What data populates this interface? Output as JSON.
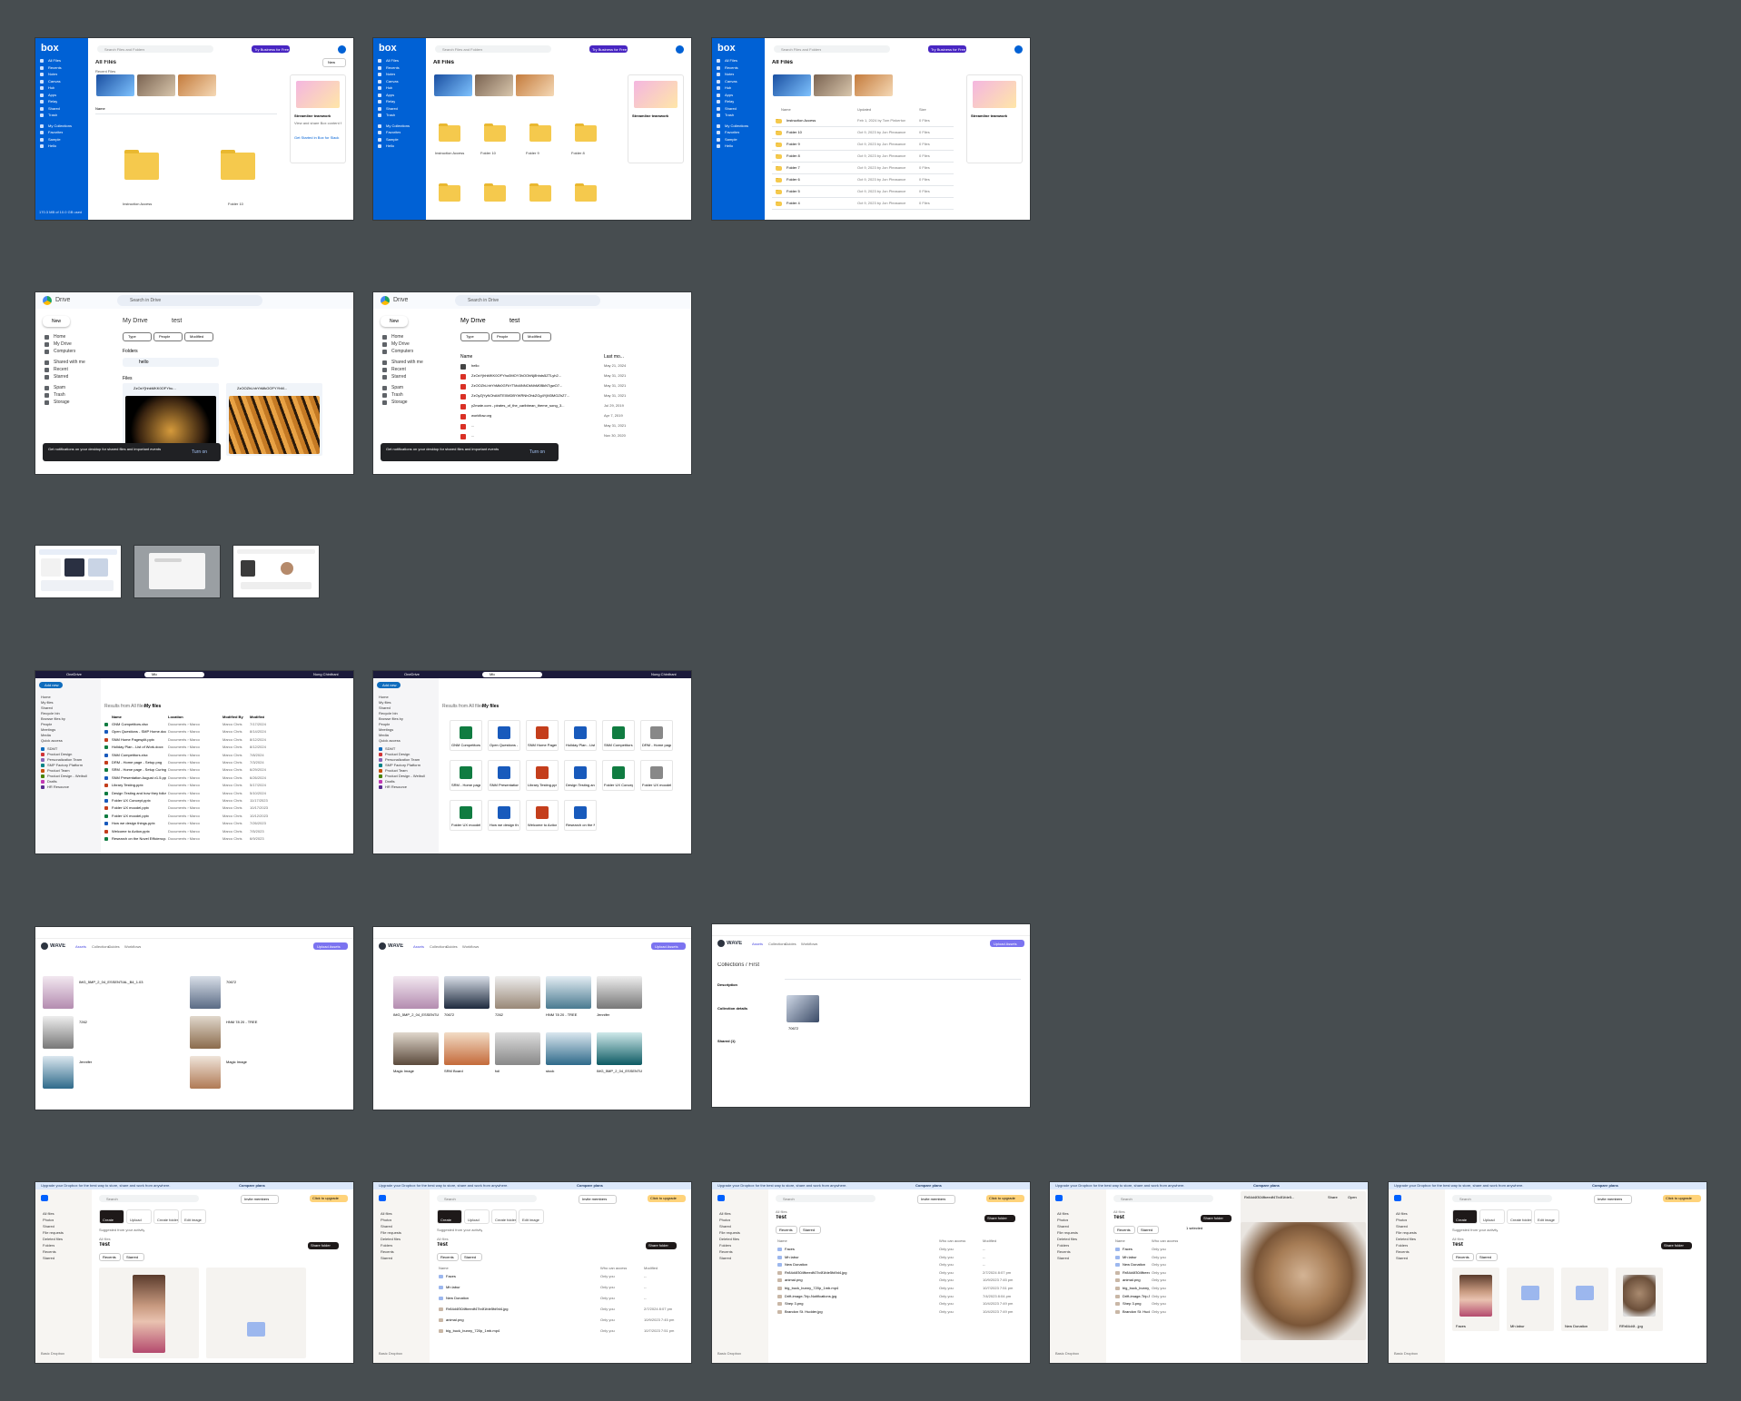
{
  "box": {
    "logo": "box",
    "nav": [
      "All Files",
      "Recents",
      "Notes",
      "Canvas",
      "Hub",
      "Apps",
      "Relay",
      "Shared",
      "Trash",
      "My Collections",
      "Favorites",
      "Sample",
      "Hello"
    ],
    "title": "All Files",
    "search_placeholder": "Search Files and Folders",
    "business_button": "Try Business for Free",
    "new_button": "New",
    "recent_label": "Recent Files",
    "section_label": "Name",
    "thumbs": [
      "Test Wallpaper Ima...",
      "3f4a9e5106e98ca...",
      "catRMDIf.png"
    ],
    "promo_title": "Streamline teamwork",
    "promo_text": "View and share Box content from Slack",
    "promo_link": "Get Started in Box for Slack",
    "storage": "170.3 MB of 10.0 GB used",
    "grid_folders": [
      {
        "name": "Instruction Access",
        "meta": "Feb 1, 2024 by Tom Pinkerton"
      },
      {
        "name": "Folder 10",
        "meta": "Oct 9, 2023 by Jon Pleasance"
      }
    ],
    "grid2_folders": [
      {
        "name": "Instruction Access",
        "meta": "Feb 1, 2024 by Tom Pinkerton"
      },
      {
        "name": "Folder 10",
        "meta": "Oct 9, 2023 by Jon Pleasance"
      },
      {
        "name": "Folder 9",
        "meta": "Oct 9, 2023 by Jon Pleasance"
      },
      {
        "name": "Folder 8",
        "meta": "Oct 9, 2023 by Jon Pleasance"
      }
    ],
    "list_rows": [
      {
        "name": "Instruction Access",
        "mod": "Feb 1, 2024 by Tom Pinkerton",
        "size": "0 Files"
      },
      {
        "name": "Folder 10",
        "mod": "Oct 9, 2023 by Jon Pleasance",
        "size": "0 Files"
      },
      {
        "name": "Folder 9",
        "mod": "Oct 9, 2023 by Jon Pleasance",
        "size": "0 Files"
      },
      {
        "name": "Folder 8",
        "mod": "Oct 9, 2023 by Jon Pleasance",
        "size": "0 Files"
      },
      {
        "name": "Folder 7",
        "mod": "Oct 9, 2023 by Jon Pleasance",
        "size": "0 Files"
      },
      {
        "name": "Folder 6",
        "mod": "Oct 9, 2023 by Jon Pleasance",
        "size": "0 Files"
      },
      {
        "name": "Folder 5",
        "mod": "Oct 9, 2023 by Jon Pleasance",
        "size": "0 Files"
      },
      {
        "name": "Folder 4",
        "mod": "Oct 9, 2023 by Jon Pleasance",
        "size": "0 Files"
      }
    ],
    "list_headers": [
      "Name",
      "Updated",
      "Size"
    ]
  },
  "gdrive": {
    "app": "Drive",
    "search_placeholder": "Search in Drive",
    "new_button": "New",
    "nav": [
      "Home",
      "My Drive",
      "Computers",
      "Shared with me",
      "Recent",
      "Starred",
      "Spam",
      "Trash",
      "Storage"
    ],
    "breadcrumb_root": "My Drive",
    "breadcrumb_folder": "test",
    "filters": [
      "Type",
      "People",
      "Modified"
    ],
    "folders_label": "Folders",
    "files_label": "Files",
    "folder_name": "hello",
    "sort_label": "Name",
    "files": [
      "ZzOzY]hhkMKK0OFYhu...",
      "ZzOOZhLhhYhMkOOFYYhM..."
    ],
    "list_headers": [
      "Name",
      "Last mo..."
    ],
    "list_rows": [
      {
        "name": "hello",
        "date": "May 21, 2024"
      },
      {
        "name": "ZzOzYjhhMKK0OFYhu0MOY3hOOhNj8hhds5ZTLyh2...",
        "date": "May 31, 2021"
      },
      {
        "name": "ZzOOZhLhhYhMk0GFkYTMd4NNOkNhM0BkNTgwO7...",
        "date": "May 31, 2021"
      },
      {
        "name": "ZzOyZjYyNOhAMTE0MDBYWRNhOhkZGg4YjM3MGZhZ7...",
        "date": "May 31, 2021"
      },
      {
        "name": "y2mate.com - pirates_of_the_caribbean_theme_song_3...",
        "date": "Jul 29, 2019"
      },
      {
        "name": "workflow.org",
        "date": "Apr 7, 2019"
      },
      {
        "name": "...",
        "date": "May 31, 2021"
      },
      {
        "name": "...",
        "date": "Nov 30, 2020"
      }
    ],
    "toast": "Get notifications on your desktop for shared files and important events",
    "toast_action": "Turn on"
  },
  "onedrive": {
    "app": "OneDrive",
    "search_value": "Mio",
    "search_scope": "My files",
    "add_button": "Add new",
    "user": "Nung Chinthani",
    "breadcrumb": [
      "Results from All files",
      "My files"
    ],
    "nav": [
      "Home",
      "My files",
      "Shared",
      "Recycle bin",
      "Browse files by",
      "People",
      "Meetings",
      "Media",
      "Quick access"
    ],
    "quick": [
      "SDMT",
      "Product Design",
      "Personalization Team",
      "SMP Factory Platform",
      "Product Team",
      "Product Design - Weibull",
      "Drafts",
      "HR Resource"
    ],
    "headers": [
      "Name",
      "Location",
      "Modified By",
      "Modified"
    ],
    "rows": [
      {
        "n": "GNM Competitors.xlsx",
        "l": "Documents › Marco",
        "m": "Marco Chris",
        "d": "7/17/2024"
      },
      {
        "n": "Open Questions - SMP Home.docx",
        "l": "Documents › Marco",
        "m": "Marco Chris",
        "d": "8/14/2024"
      },
      {
        "n": "SNM Home Pagesplit.pptx",
        "l": "Documents › Marco",
        "m": "Marco Chris",
        "d": "8/12/2024"
      },
      {
        "n": "Holiday Plan - List of Work.docx",
        "l": "Documents › Marco",
        "m": "Marco Chris",
        "d": "8/12/2024"
      },
      {
        "n": "SNM Competitors.xlsx",
        "l": "Documents › Marco",
        "m": "Marco Chris",
        "d": "7/8/2024"
      },
      {
        "n": "DRM - Home page - Setup.png",
        "l": "Documents › Marco",
        "m": "Marco Chris",
        "d": "7/3/2024"
      },
      {
        "n": "SRM - Home page - Setup Curing",
        "l": "Documents › Marco",
        "m": "Marco Chris",
        "d": "6/29/2024"
      },
      {
        "n": "SNM Presentation August v1.5.pptx",
        "l": "Documents › Marco",
        "m": "Marco Chris",
        "d": "6/26/2024"
      },
      {
        "n": "Library Testing.pptx",
        "l": "Documents › Marco",
        "m": "Marco Chris",
        "d": "5/17/2024"
      },
      {
        "n": "Design Testing and how they follow.docx",
        "l": "Documents › Marco",
        "m": "Marco Chris",
        "d": "5/10/2024"
      },
      {
        "n": "Folder UX Concept.pptx",
        "l": "Documents › Marco",
        "m": "Marco Chris",
        "d": "11/17/2023"
      },
      {
        "n": "Folder UX moodel.pptx",
        "l": "Documents › Marco",
        "m": "Marco Chris",
        "d": "10/17/2023"
      },
      {
        "n": "Folder UX moodel.pptx",
        "l": "Documents › Marco",
        "m": "Marco Chris",
        "d": "10/12/2023"
      },
      {
        "n": "How we design things.pptx",
        "l": "Documents › Marco",
        "m": "Marco Chris",
        "d": "7/26/2023"
      },
      {
        "n": "Welcome to Action.pptx",
        "l": "Documents › Marco",
        "m": "Marco Chris",
        "d": "7/5/2023"
      },
      {
        "n": "Research on the Novel Efficiency.docx",
        "l": "Documents › Marco",
        "m": "Marco Chris",
        "d": "6/9/2023"
      }
    ]
  },
  "wave": {
    "app": "WAVE",
    "tabs": [
      "Assets",
      "Collections",
      "Guides",
      "Workflows"
    ],
    "upload": "Upload Assets",
    "collection_title": "Collections / First",
    "description_label": "Description",
    "details_label": "Collection details",
    "shared_label": "Shared (1)",
    "assets": [
      "IMG_5MP_2_04_ESSENTIAL_B4_1.03",
      "70672",
      "7262",
      "HNM 78 20 - TREE",
      "Jennifer",
      "Magic Image",
      "SRM Board",
      "foil",
      "stock"
    ]
  },
  "dropbox": {
    "banner": "Upgrade your Dropbox for the best way to store, share and work from anywhere.",
    "banner_link": "Compare plans",
    "search_placeholder": "Search",
    "invite": "Invite members",
    "upgrade": "Click to upgrade",
    "nav": [
      "All files",
      "Photos",
      "Shared",
      "File requests",
      "Deleted files",
      "Folders",
      "Recents",
      "Starred"
    ],
    "actions": [
      "Create",
      "Upload",
      "Create folder",
      "Edit image"
    ],
    "suggested": "Suggested from your activity",
    "breadcrumb": "All files",
    "title": "Test",
    "share_folder": "Share folder",
    "chips": [
      "Recents",
      "Starred"
    ],
    "headers": [
      "Name",
      "Who can access",
      "Modified"
    ],
    "rows": [
      {
        "n": "Faces",
        "w": "Only you",
        "d": "--"
      },
      {
        "n": "Mh labur",
        "w": "Only you",
        "d": "--"
      },
      {
        "n": "New Donation",
        "w": "Only you",
        "d": "--"
      },
      {
        "n": "Rr84d4f304fbeedf47b4f1fde5fd9d4.jpg",
        "w": "Only you",
        "d": "2/7/2024 8:07 pm"
      },
      {
        "n": "animal.png",
        "w": "Only you",
        "d": "10/9/2023 7:45 pm"
      },
      {
        "n": "big_buck_bunny_720p_1mb.mp4",
        "w": "Only you",
        "d": "10/7/2023 7:51 pm"
      },
      {
        "n": "Drift-image-Trip-Notifications.jpg",
        "w": "Only you",
        "d": "7/4/2023 8:04 pm"
      },
      {
        "n": "Shep 3.png",
        "w": "Only you",
        "d": "10/4/2023 7:49 pm"
      },
      {
        "n": "Brandon St. Hudder.jpg",
        "w": "Only you",
        "d": "10/4/2023 7:49 pm"
      }
    ],
    "grid": [
      {
        "n": "Faces",
        "m": "Folder · Photos"
      },
      {
        "n": "Mh labur",
        "m": "Folder · Photos"
      },
      {
        "n": "New Donation",
        "m": "Folder · Photos"
      },
      {
        "n": "RRr84d4f...jpg",
        "m": "RR84d4f30...Face"
      }
    ],
    "preview_file": "Rr84d4f304fbeedf47b4f1fde5...",
    "share": "Share",
    "open": "Open",
    "selected": "1 selected",
    "storage": "Basic Dropbox"
  }
}
